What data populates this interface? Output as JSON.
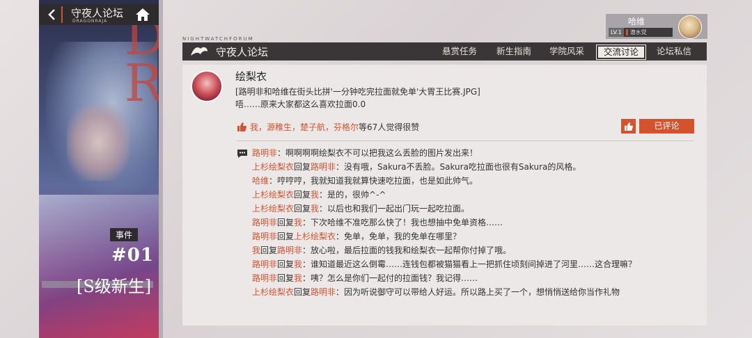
{
  "header": {
    "title": "守夜人论坛",
    "subtitle": "DRAGONRAJA"
  },
  "event": {
    "badge": "事件",
    "number": "#01",
    "title": "[S级新生]"
  },
  "user": {
    "name": "哈维",
    "level": "LV.1",
    "faction": "潜水党"
  },
  "forum_bar": {
    "label": "NIGHTWATCHFORUM",
    "title": "守夜人论坛",
    "tabs": [
      {
        "label": "悬赏任务",
        "active": false
      },
      {
        "label": "新生指南",
        "active": false
      },
      {
        "label": "学院风采",
        "active": false
      },
      {
        "label": "交流讨论",
        "active": true
      },
      {
        "label": "论坛私信",
        "active": false
      }
    ]
  },
  "post": {
    "author": "绘梨衣",
    "line1": "[路明非和哈维在街头比拼'一分钟吃完拉面就免单'大胃王比赛.JPG]",
    "line2": "唔……原来大家都这么喜欢拉面0.0",
    "likes_names": "我，源稚生，楚子航，芬格尔",
    "likes_rest": "等67人觉得很赞",
    "comment_button": "已评论"
  },
  "comments": [
    {
      "from": "路明非",
      "reply": "",
      "to": "",
      "text": "：啊啊啊啊绘梨衣不可以把我这么丢脸的图片发出来！"
    },
    {
      "from": "上杉绘梨衣",
      "reply": "回复",
      "to": "路明非",
      "text": "：没有哦，Sakura不丢脸。Sakura吃拉面也很有Sakura的风格。"
    },
    {
      "from": "哈维",
      "reply": "",
      "to": "",
      "text": "：哼哼哼，我就知道我就算快速吃拉面，也是如此帅气。"
    },
    {
      "from": "上杉绘梨衣",
      "reply": "回复",
      "to": "我",
      "text": "：是的，很帅^-^"
    },
    {
      "from": "上杉绘梨衣",
      "reply": "回复",
      "to": "我",
      "text": "：以后也和我们一起出门玩一起吃拉面。"
    },
    {
      "from": "路明非",
      "reply": "回复",
      "to": "我",
      "text": "：下次哈维不准吃那么快了！我也想抽中免单资格……"
    },
    {
      "from": "路明非",
      "reply": "回复",
      "to": "上杉绘梨衣",
      "text": "：免单，免单，我的免单在哪里？"
    },
    {
      "from": "我",
      "reply": "回复",
      "to": "路明非",
      "text": "：放心啦，最后拉面的钱我和绘梨衣一起帮你付掉了哦。"
    },
    {
      "from": "路明非",
      "reply": "回复",
      "to": "我",
      "text": "：谁知道最近这么倒霉……连钱包都被猫猫看上一把抓住顷刻间掉进了河里……这合理嘛？"
    },
    {
      "from": "路明非",
      "reply": "回复",
      "to": "我",
      "text": "：咦？怎么是你们一起付的拉面钱？我记得……"
    },
    {
      "from": "上杉绘梨衣",
      "reply": "回复",
      "to": "路明非",
      "text": "：因为听说御守可以带给人好运。所以路上买了一个，想悄悄送给你当作礼物"
    }
  ],
  "colors": {
    "accent": "#d5522e",
    "dark_bar": "#3a3638",
    "card_bg": "#ebe8e7"
  }
}
